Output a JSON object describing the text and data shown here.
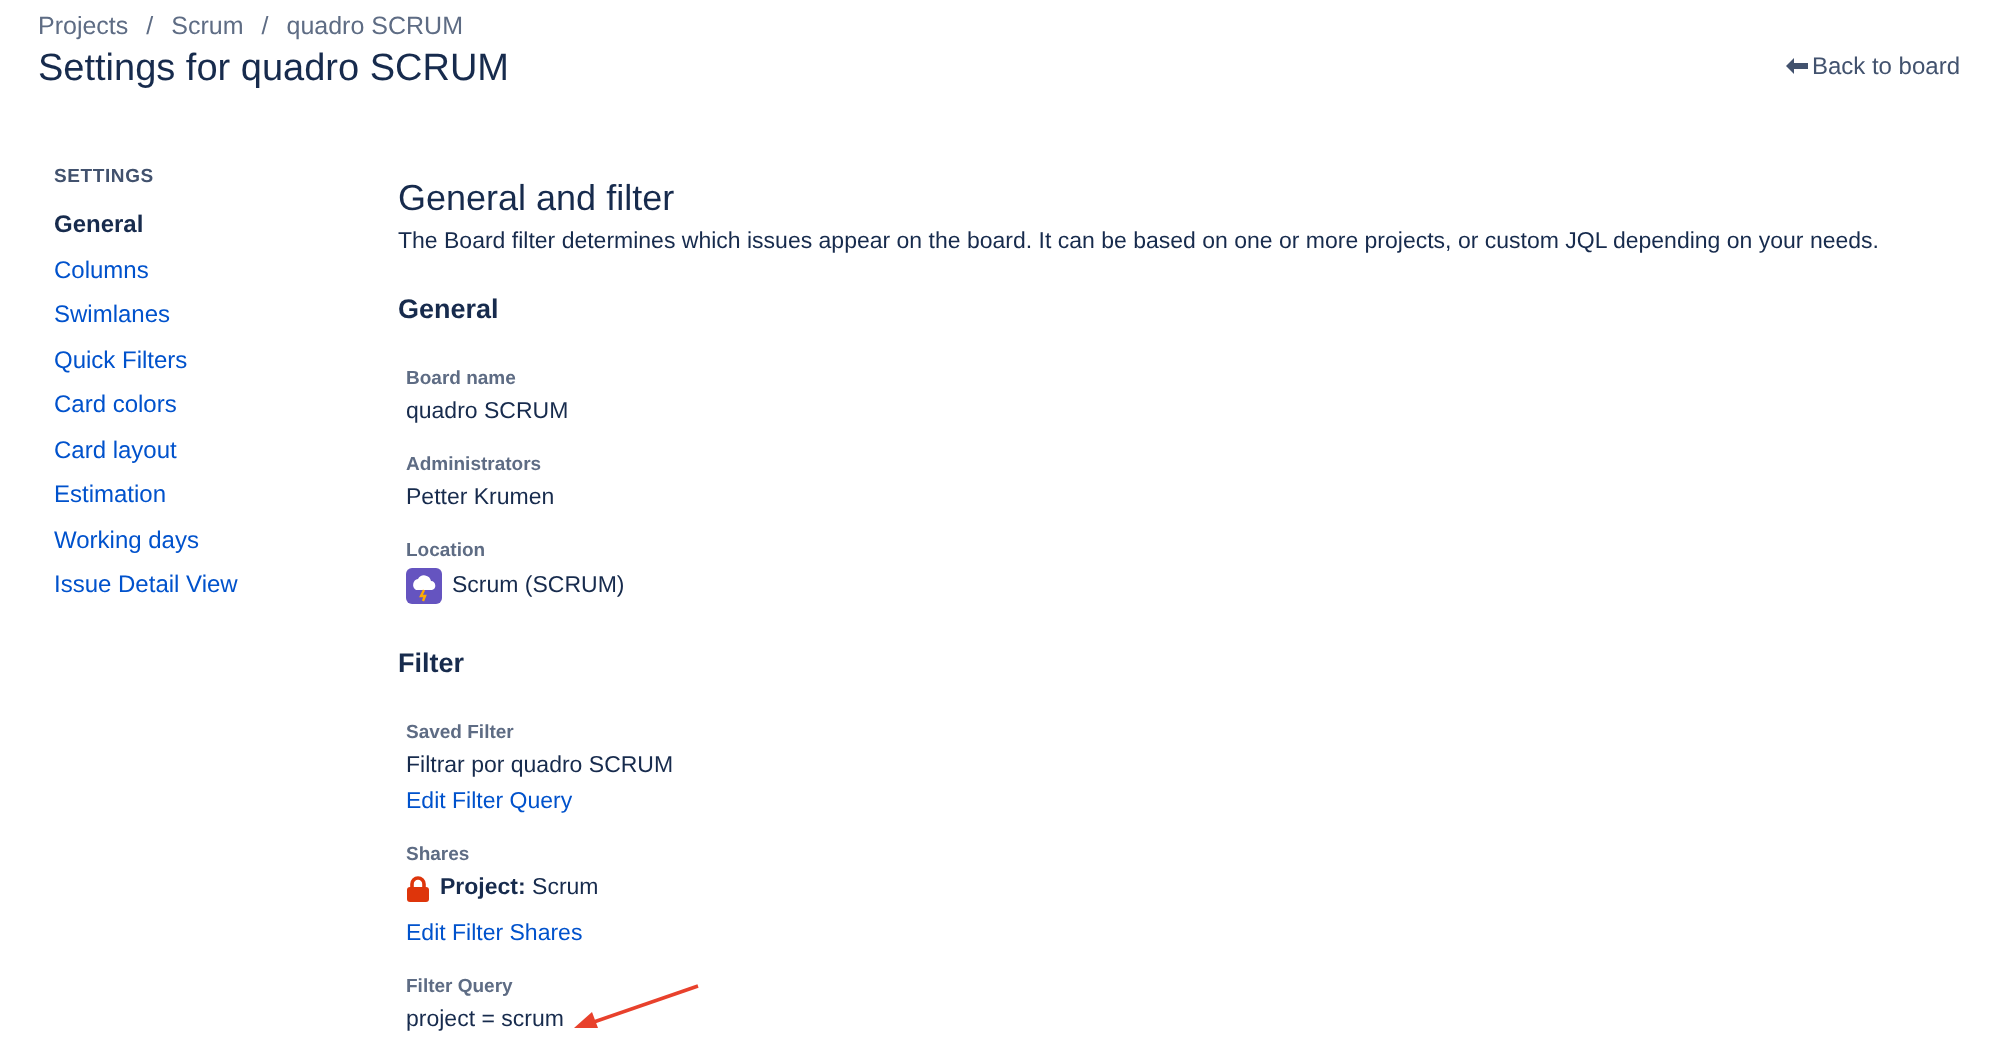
{
  "breadcrumbs": [
    "Projects",
    "Scrum",
    "quadro SCRUM"
  ],
  "breadcrumb_separators": [
    "/",
    "/"
  ],
  "page_title": "Settings for quadro SCRUM",
  "back_link": "Back to board",
  "sidebar": {
    "heading": "SETTINGS",
    "items": [
      {
        "label": "General",
        "selected": true
      },
      {
        "label": "Columns",
        "selected": false
      },
      {
        "label": "Swimlanes",
        "selected": false
      },
      {
        "label": "Quick Filters",
        "selected": false
      },
      {
        "label": "Card colors",
        "selected": false
      },
      {
        "label": "Card layout",
        "selected": false
      },
      {
        "label": "Estimation",
        "selected": false
      },
      {
        "label": "Working days",
        "selected": false
      },
      {
        "label": "Issue Detail View",
        "selected": false
      }
    ]
  },
  "main": {
    "title": "General and filter",
    "description": "The Board filter determines which issues appear on the board. It can be based on one or more projects, or custom JQL depending on your needs.",
    "sections": [
      {
        "title": "General",
        "fields": [
          {
            "label": "Board name",
            "items": [
              {
                "kind": "text",
                "text": "quadro SCRUM"
              }
            ]
          },
          {
            "label": "Administrators",
            "items": [
              {
                "kind": "text",
                "text": "Petter Krumen"
              }
            ]
          },
          {
            "label": "Location",
            "items": [
              {
                "kind": "project",
                "text": "Scrum (SCRUM)"
              }
            ]
          }
        ]
      },
      {
        "title": "Filter",
        "fields": [
          {
            "label": "Saved Filter",
            "items": [
              {
                "kind": "text",
                "text": "Filtrar por quadro SCRUM"
              },
              {
                "kind": "link",
                "text": "Edit Filter Query"
              }
            ]
          },
          {
            "label": "Shares",
            "items": [
              {
                "kind": "share",
                "text": "**Project:** Scrum"
              },
              {
                "kind": "link",
                "text": "Edit Filter Shares"
              }
            ]
          },
          {
            "label": "Filter Query",
            "items": [
              {
                "kind": "text",
                "text": "project = scrum",
                "annotated": true
              }
            ]
          }
        ]
      }
    ]
  }
}
